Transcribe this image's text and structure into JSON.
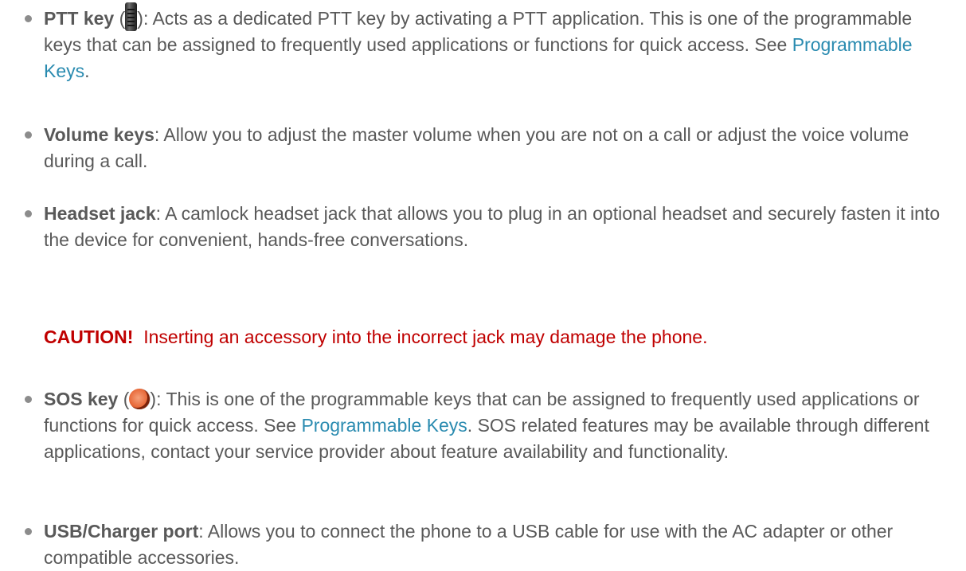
{
  "items": [
    {
      "term": "PTT key",
      "paren_open": " (",
      "icon": "ptt-key-icon",
      "paren_close": "): ",
      "text_before_link": "Acts as a dedicated PTT key by activating a PTT application. This is one of the programmable keys that can be assigned to frequently used applications or functions for quick access. See ",
      "link": "Programmable Keys",
      "text_after_link": "."
    },
    {
      "term": "Volume keys",
      "text": ": Allow you to adjust the master volume when you are not on a call or adjust the voice volume during a call."
    },
    {
      "term": "Headset jack",
      "text": ": A camlock headset jack that allows you to plug in an optional headset and securely fasten it into the device for convenient, hands-free conversations."
    },
    {
      "term": "SOS key",
      "paren_open": " (",
      "icon": "sos-key-icon",
      "paren_close": "): ",
      "text_before_link": "This is one of the programmable keys that can be assigned to frequently used applications or functions for quick access. See ",
      "link": "Programmable Keys",
      "text_after_link": ". SOS related features may be available through different applications, contact your service provider about feature availability and functionality."
    },
    {
      "term": "USB/Charger port",
      "text": ": Allows you to connect the phone to a USB cable for use with the AC adapter or other compatible accessories."
    }
  ],
  "caution": {
    "label": "CAUTION!",
    "text": "Inserting an accessory into the incorrect jack may damage the phone."
  },
  "colors": {
    "body_text": "#595959",
    "link": "#2a8bb0",
    "caution": "#c00000"
  }
}
